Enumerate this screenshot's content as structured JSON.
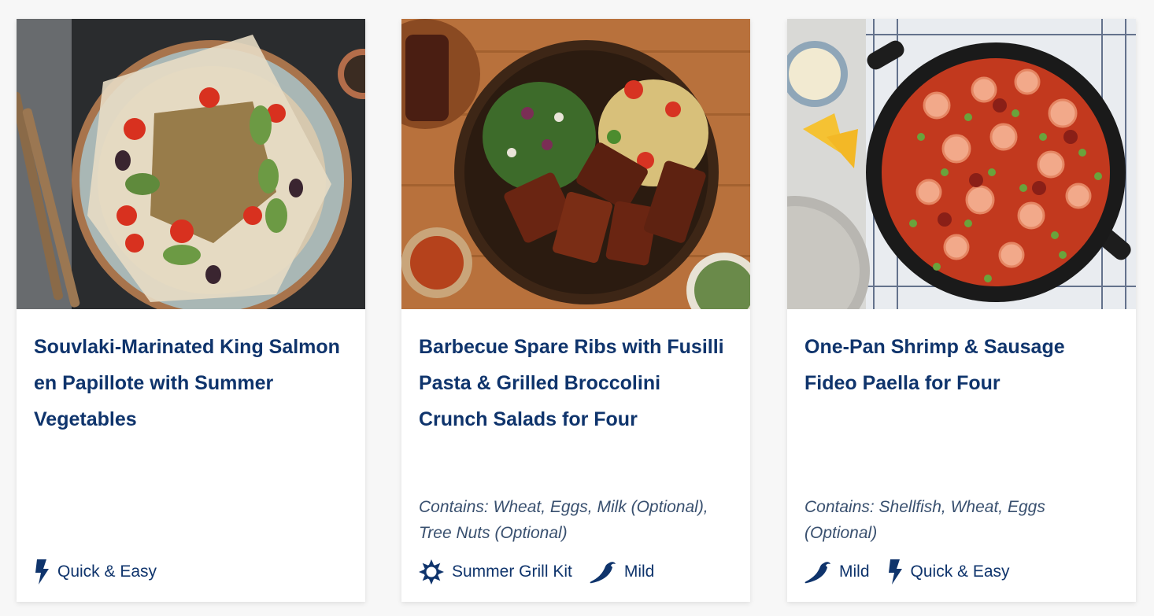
{
  "colors": {
    "title": "#0f346c",
    "text": "#39506f",
    "card_bg": "#ffffff",
    "page_bg": "#f7f7f7"
  },
  "cards": [
    {
      "title": "Souvlaki-Marinated King Salmon en Papillote with Summer Vegetables",
      "allergens": "",
      "tags": [
        {
          "icon": "lightning-icon",
          "label": "Quick & Easy"
        }
      ]
    },
    {
      "title": "Barbecue Spare Ribs with Fusilli Pasta & Grilled Broccolini Crunch Salads for Four",
      "allergens": "Contains: Wheat, Eggs, Milk (Optional), Tree Nuts (Optional)",
      "tags": [
        {
          "icon": "sun-icon",
          "label": "Summer Grill Kit"
        },
        {
          "icon": "chili-pepper-icon",
          "label": "Mild"
        }
      ]
    },
    {
      "title": "One-Pan Shrimp & Sausage Fideo Paella for Four",
      "allergens": "Contains: Shellfish, Wheat, Eggs (Optional)",
      "tags": [
        {
          "icon": "chili-pepper-icon",
          "label": "Mild"
        },
        {
          "icon": "lightning-icon",
          "label": "Quick & Easy"
        }
      ]
    }
  ]
}
